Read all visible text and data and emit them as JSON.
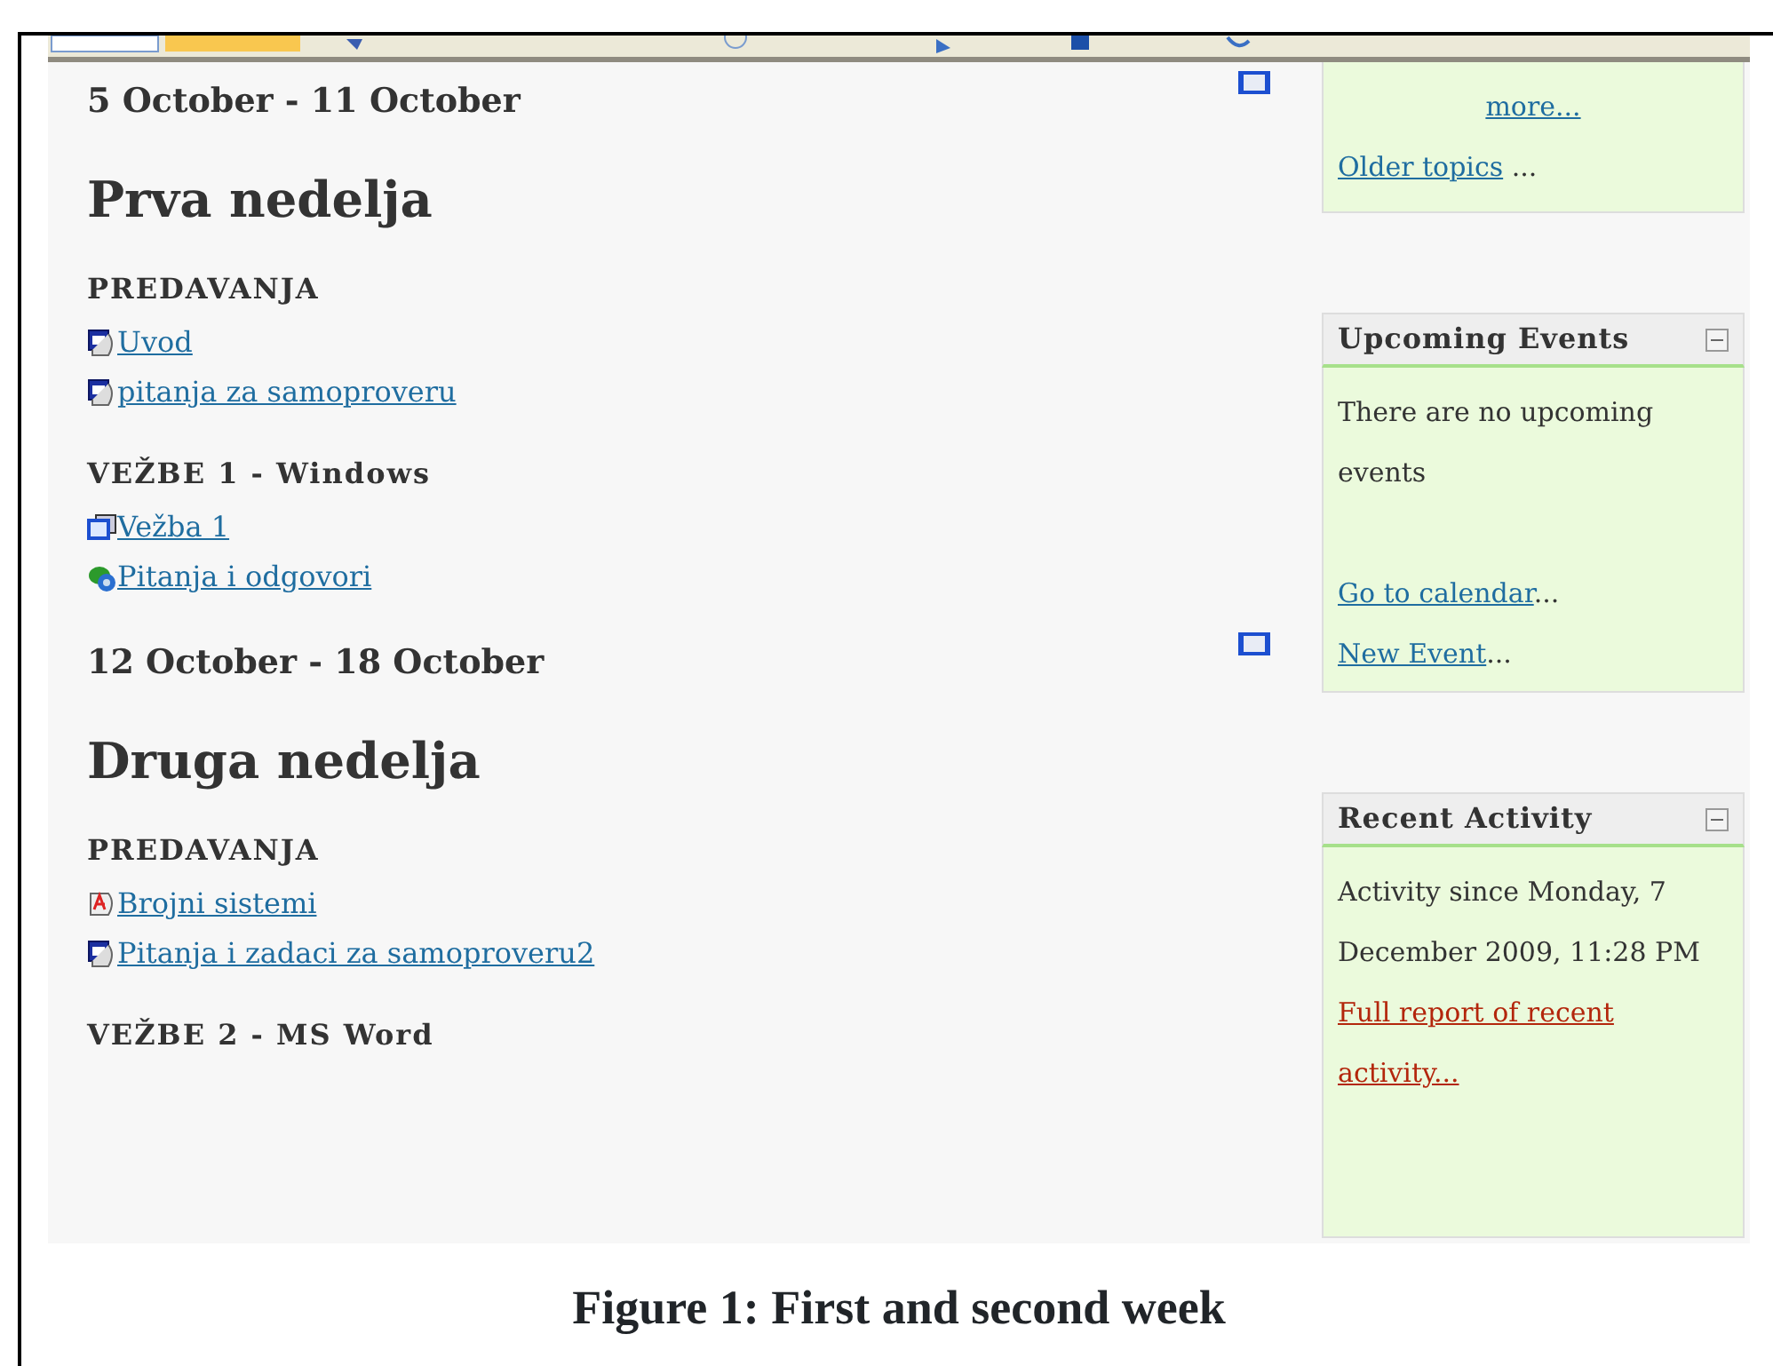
{
  "weeks": [
    {
      "dates": "5 October - 11 October",
      "title": "Prva nedelja",
      "sections": [
        {
          "heading": "PREDAVANJA",
          "items": [
            {
              "kind": "word",
              "label": " Uvod"
            },
            {
              "kind": "word",
              "label": " pitanja za samoproveru"
            }
          ]
        },
        {
          "heading": "VEŽBE 1 - Windows",
          "items": [
            {
              "kind": "assignment",
              "label": " Vežba 1"
            },
            {
              "kind": "forum",
              "label": " Pitanja i odgovori"
            }
          ]
        }
      ]
    },
    {
      "dates": "12 October - 18 October",
      "title": "Druga nedelja",
      "sections": [
        {
          "heading": "PREDAVANJA",
          "items": [
            {
              "kind": "pdf",
              "label": " Brojni sistemi"
            },
            {
              "kind": "word",
              "label": " Pitanja i zadaci za samoproveru2"
            }
          ]
        },
        {
          "heading": "VEŽBE 2 - MS Word"
        }
      ]
    }
  ],
  "sidebar": {
    "news": {
      "more_link": "more...",
      "older_link": "Older topics",
      "older_suffix": " ..."
    },
    "upcoming": {
      "title": "Upcoming Events",
      "text": "There are no upcoming events",
      "links": [
        {
          "label": "Go to calendar",
          "suffix": "..."
        },
        {
          "label": "New Event",
          "suffix": "..."
        }
      ]
    },
    "recent": {
      "title": "Recent Activity",
      "text": "Activity since Monday, 7 December 2009, 11:28 PM",
      "report_link": "Full report of recent activity..."
    }
  },
  "caption": "Figure 1: First and second week"
}
